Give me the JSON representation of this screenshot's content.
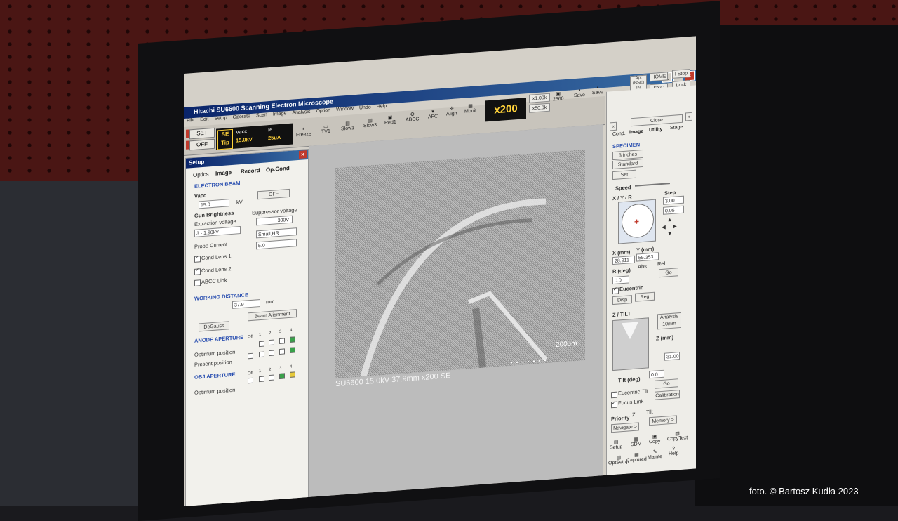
{
  "window": {
    "title": "Hitachi SU6600 Scanning Electron Microscope"
  },
  "menu": [
    "File",
    "Edit",
    "Setup",
    "Operate",
    "Scan",
    "Image",
    "Analysis",
    "Option",
    "Window",
    "Undo",
    "Help"
  ],
  "toolbar": {
    "set_label": "SET",
    "off_label": "OFF",
    "se_tag": "SE Tip",
    "vacc_label": "Vacc",
    "ie_label": "Ie",
    "vacc_value": "15.0kV",
    "ie_value": "25uA",
    "buttons": [
      "Freeze",
      "TV1",
      "Slow1",
      "Slow3",
      "Red1",
      "ABCC",
      "AFC",
      "Align",
      "Monit"
    ],
    "magnification": "x200",
    "zoom_1k": "x1.00k",
    "zoom_50k": "x50.0k",
    "res": "2560",
    "save1": "Save",
    "save2": "Save",
    "apt": "Apt (BSE) IN",
    "home": "HOME",
    "exc": "EXC",
    "stop": "I Stop",
    "lock": "Lock"
  },
  "setup": {
    "title": "Setup",
    "tabs": [
      "Optics",
      "Image",
      "Record",
      "Op.Cond"
    ],
    "electron_beam": "ELECTRON BEAM",
    "vacc_label": "Vacc",
    "vacc_value": "15.0",
    "vacc_unit": "kV",
    "off_btn": "OFF",
    "gun_brightness": "Gun Brightness",
    "extraction_voltage": "Extraction voltage",
    "extraction_value": "3 - 1.90kV",
    "suppressor_voltage": "Suppressor voltage",
    "suppressor_value": "300V",
    "probe_current": "Probe Current",
    "probe_value": "Small,HR",
    "cond_lens_1": "Cond Lens 1",
    "cond_lens_1_value": "5.0",
    "cond_lens_2": "Cond Lens 2",
    "abcc_link": "ABCC Link",
    "working_distance": "WORKING DISTANCE",
    "wd_value": "37.9",
    "wd_unit": "mm",
    "degauss": "DeGauss",
    "beam_alignment": "Beam Alignment",
    "anode_aperture": "ANODE APERTURE",
    "optimum_position": "Optimum position",
    "present_position": "Present position",
    "obj_aperture": "OBJ APERTURE",
    "obj_optimum": "Optimum position",
    "aperture_cols": [
      "Off",
      "1",
      "2",
      "3",
      "4"
    ]
  },
  "image": {
    "caption": "SU6600 15.0kV 37.9mm x200 SE",
    "scale": "200um"
  },
  "stage": {
    "close": "Close",
    "tabs": [
      "Cond.",
      "Image",
      "Utility",
      "Stage"
    ],
    "specimen": "SPECIMEN",
    "size": "3 inches",
    "standard": "Standard",
    "set": "Set",
    "speed": "Speed",
    "xyr": "X / Y / R",
    "step": "Step",
    "step_x": "3.00",
    "step_y": "0.05",
    "x_label": "X (mm)",
    "y_label": "Y (mm)",
    "x_value": "28.911",
    "y_value": "55.353",
    "r_label": "R (deg)",
    "r_value": "0.0",
    "abs": "Abs",
    "rel": "Rel",
    "go": "Go",
    "eucentric": "Eucentric",
    "disp": "Disp",
    "reg": "Reg",
    "z_tilt": "Z / TILT",
    "analysis": "Analysis 10mm",
    "z_label": "Z (mm)",
    "z_value": "31.00",
    "tilt_label": "Tilt (deg)",
    "tilt_value": "0.0",
    "go2": "Go",
    "eucentric_tilt": "Eucentric Tilt",
    "focus_link": "Focus Link",
    "calibration": "Calibration",
    "priority": "Priority",
    "pz": "Z",
    "ptilt": "Tilt",
    "navigate": "Navigate >",
    "memory": "Memory >",
    "bottom_tools": [
      "Setup",
      "SDM",
      "Copy",
      "CopyText",
      "OptSetup",
      "Captured",
      "Mainte",
      "Help"
    ]
  },
  "credit": "foto. © Bartosz Kudła 2023"
}
